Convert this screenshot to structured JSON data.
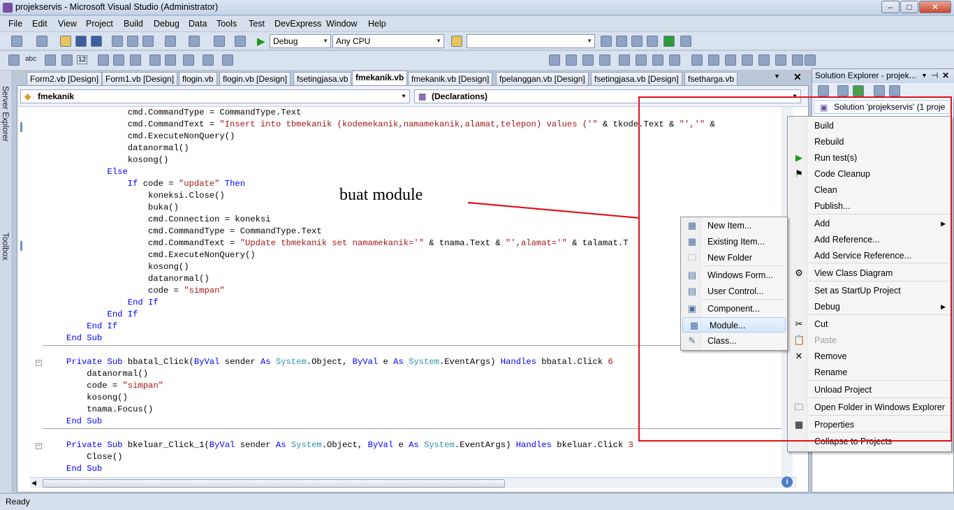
{
  "window": {
    "title": "projekservis - Microsoft Visual Studio (Administrator)",
    "minimize": "–",
    "maximize": "□",
    "close": "✕"
  },
  "menubar": [
    "File",
    "Edit",
    "View",
    "Project",
    "Build",
    "Debug",
    "Data",
    "Tools",
    "Test",
    "DevExpress",
    "Window",
    "Help"
  ],
  "toolbar": {
    "config": "Debug",
    "platform": "Any CPU",
    "abc": "abc",
    "num": "12"
  },
  "sidebar": {
    "server_explorer": "Server Explorer",
    "toolbox": "Toolbox"
  },
  "tabs": [
    "Form2.vb [Design]",
    "Form1.vb [Design]",
    "flogin.vb",
    "flogin.vb [Design]",
    "fsetingjasa.vb",
    "fmekanik.vb",
    "fmekanik.vb [Design]",
    "fpelanggan.vb [Design]",
    "fsetingjasa.vb [Design]",
    "fsetharga.vb"
  ],
  "active_tab": "fmekanik.vb",
  "nav": {
    "left": "fmekanik",
    "right": "(Declarations)"
  },
  "code": [
    [
      "            ",
      [
        "",
        "cmd.CommandType = CommandType.Text"
      ]
    ],
    [
      "            ",
      [
        "",
        "cmd.CommandText = "
      ],
      [
        "st",
        "\"Insert into tbmekanik (kodemekanik,namamekanik,alamat,telepon) values ('\""
      ],
      [
        "",
        " & tkode.Text & "
      ],
      [
        "st",
        "\"','\""
      ],
      [
        "",
        " &"
      ]
    ],
    [
      "            ",
      [
        "",
        "cmd.ExecuteNonQuery()"
      ]
    ],
    [
      "            ",
      [
        "",
        "datanormal()"
      ]
    ],
    [
      "            ",
      [
        "",
        "kosong()"
      ]
    ],
    [
      "        ",
      [
        "kw",
        "Else"
      ]
    ],
    [
      "            ",
      [
        "kw",
        "If"
      ],
      [
        "",
        " code = "
      ],
      [
        "st",
        "\"update\""
      ],
      [
        "",
        " "
      ],
      [
        "kw",
        "Then"
      ]
    ],
    [
      "                ",
      [
        "",
        "koneksi.Close()"
      ]
    ],
    [
      "                ",
      [
        "",
        "buka()"
      ]
    ],
    [
      "                ",
      [
        "",
        "cmd.Connection = koneksi"
      ]
    ],
    [
      "                ",
      [
        "",
        "cmd.CommandType = CommandType.Text"
      ]
    ],
    [
      "                ",
      [
        "",
        "cmd.CommandText = "
      ],
      [
        "st",
        "\"Update tbmekanik set namamekanik='\""
      ],
      [
        "",
        " & tnama.Text & "
      ],
      [
        "st",
        "\"',alamat='\""
      ],
      [
        "",
        " & talamat.T"
      ]
    ],
    [
      "                ",
      [
        "",
        "cmd.ExecuteNonQuery()"
      ]
    ],
    [
      "                ",
      [
        "",
        "kosong()"
      ]
    ],
    [
      "                ",
      [
        "",
        "datanormal()"
      ]
    ],
    [
      "                ",
      [
        "",
        "code = "
      ],
      [
        "st",
        "\"simpan\""
      ]
    ],
    [
      "            ",
      [
        "kw",
        "End If"
      ]
    ],
    [
      "        ",
      [
        "kw",
        "End If"
      ]
    ],
    [
      "    ",
      [
        "kw",
        "End If"
      ]
    ],
    [
      "",
      [
        "kw",
        "End Sub"
      ]
    ],
    [
      "",
      [
        "",
        ""
      ]
    ],
    [
      "",
      [
        "kw",
        "Private Sub"
      ],
      [
        "",
        " bbatal_Click("
      ],
      [
        "kw",
        "ByVal"
      ],
      [
        "",
        " sender "
      ],
      [
        "kw",
        "As"
      ],
      [
        "gy",
        " System"
      ],
      [
        "",
        ".Object, "
      ],
      [
        "kw",
        "ByVal"
      ],
      [
        "",
        " e "
      ],
      [
        "kw",
        "As"
      ],
      [
        "gy",
        " System"
      ],
      [
        "",
        ".EventArgs) "
      ],
      [
        "kw",
        "Handles"
      ],
      [
        "",
        " bbatal.Click "
      ],
      [
        "st",
        "6"
      ]
    ],
    [
      "    ",
      [
        "",
        "datanormal()"
      ]
    ],
    [
      "    ",
      [
        "",
        "code = "
      ],
      [
        "st",
        "\"simpan\""
      ]
    ],
    [
      "    ",
      [
        "",
        "kosong()"
      ]
    ],
    [
      "    ",
      [
        "",
        "tnama.Focus()"
      ]
    ],
    [
      "",
      [
        "kw",
        "End Sub"
      ]
    ],
    [
      "",
      [
        "",
        ""
      ]
    ],
    [
      "",
      [
        "kw",
        "Private Sub"
      ],
      [
        "",
        " bkeluar_Click_1("
      ],
      [
        "kw",
        "ByVal"
      ],
      [
        "",
        " sender "
      ],
      [
        "kw",
        "As"
      ],
      [
        "gy",
        " System"
      ],
      [
        "",
        ".Object, "
      ],
      [
        "kw",
        "ByVal"
      ],
      [
        "",
        " e "
      ],
      [
        "kw",
        "As"
      ],
      [
        "gy",
        " System"
      ],
      [
        "",
        ".EventArgs) "
      ],
      [
        "kw",
        "Handles"
      ],
      [
        "",
        " bkeluar.Click "
      ],
      [
        "st",
        "3"
      ]
    ],
    [
      "    ",
      [
        "",
        "Close()"
      ]
    ],
    [
      "",
      [
        "kw",
        "End Sub"
      ]
    ]
  ],
  "solution_explorer": {
    "title": "Solution Explorer - projek...",
    "root": "Solution 'projekservis' (1 proje"
  },
  "context_menu": {
    "items": [
      {
        "label": "Build",
        "icon": ""
      },
      {
        "label": "Rebuild",
        "icon": ""
      },
      {
        "label": "Run test(s)",
        "icon": "▶"
      },
      {
        "label": "Code Cleanup",
        "icon": "⚑"
      },
      {
        "label": "Clean",
        "icon": ""
      },
      {
        "label": "Publish...",
        "icon": ""
      },
      {
        "label": "Add",
        "icon": "",
        "submenu": true
      },
      {
        "label": "Add Reference...",
        "icon": ""
      },
      {
        "label": "Add Service Reference...",
        "icon": ""
      },
      {
        "label": "View Class Diagram",
        "icon": "⚙"
      },
      {
        "label": "Set as StartUp Project",
        "icon": ""
      },
      {
        "label": "Debug",
        "icon": "",
        "submenu": true
      },
      {
        "label": "Cut",
        "icon": "✂"
      },
      {
        "label": "Paste",
        "icon": "📋",
        "disabled": true
      },
      {
        "label": "Remove",
        "icon": "✕"
      },
      {
        "label": "Rename",
        "icon": ""
      },
      {
        "label": "Unload Project",
        "icon": ""
      },
      {
        "label": "Open Folder in Windows Explorer",
        "icon": "🗀"
      },
      {
        "label": "Properties",
        "icon": "▦"
      },
      {
        "label": "Collapse to Projects",
        "icon": ""
      }
    ]
  },
  "add_submenu": {
    "items": [
      {
        "label": "New Item...",
        "icon": "▦"
      },
      {
        "label": "Existing Item...",
        "icon": "▦"
      },
      {
        "label": "New Folder",
        "icon": "🗀"
      },
      {
        "label": "Windows Form...",
        "icon": "▤"
      },
      {
        "label": "User Control...",
        "icon": "▤"
      },
      {
        "label": "Component...",
        "icon": "▣"
      },
      {
        "label": "Module...",
        "icon": "▦",
        "selected": true
      },
      {
        "label": "Class...",
        "icon": "✎"
      }
    ]
  },
  "annotation": {
    "text": "buat module",
    "color": "#e0121d"
  },
  "status": {
    "text": "Ready"
  }
}
